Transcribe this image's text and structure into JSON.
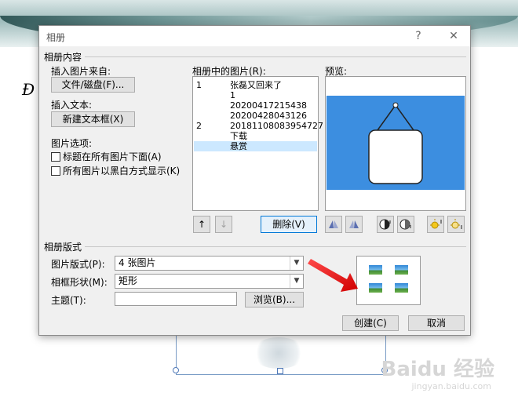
{
  "dialog": {
    "title": "相册",
    "help_glyph": "?",
    "close_glyph": "✕"
  },
  "album_content": {
    "group_label": "相册内容",
    "insert_picture_from": "插入图片来自:",
    "file_disk_button": "文件/磁盘(F)...",
    "insert_text": "插入文本:",
    "new_textbox_button": "新建文本框(X)",
    "picture_options": "图片选项:",
    "caption_below_all": "标题在所有图片下面(A)",
    "all_black_white": "所有图片以黑白方式显示(K)"
  },
  "pictures_list": {
    "label": "相册中的图片(R):",
    "items": [
      {
        "num": "1",
        "name": "张磊又回来了",
        "selected": false
      },
      {
        "num": "",
        "name": "1",
        "selected": false
      },
      {
        "num": "",
        "name": "20200417215438",
        "selected": false
      },
      {
        "num": "",
        "name": "20200428043126",
        "selected": false
      },
      {
        "num": "2",
        "name": "20181108083954727",
        "selected": false
      },
      {
        "num": "",
        "name": "下载",
        "selected": false
      },
      {
        "num": "",
        "name": "悬赏",
        "selected": true
      }
    ],
    "move_up_glyph": "↑",
    "move_down_glyph": "↓",
    "delete_button": "删除(V)"
  },
  "preview": {
    "label": "预览:",
    "background_color": "#3c8ee0",
    "tool_icons": [
      "rotate-left-icon",
      "rotate-right-icon",
      "contrast-up-icon",
      "contrast-down-icon",
      "brightness-up-icon",
      "brightness-down-icon"
    ]
  },
  "album_layout": {
    "group_label": "相册版式",
    "picture_layout_label": "图片版式(P):",
    "picture_layout_value": "4 张图片",
    "frame_shape_label": "相框形状(M):",
    "frame_shape_value": "矩形",
    "theme_label": "主题(T):",
    "theme_value": "",
    "browse_button": "浏览(B)..."
  },
  "footer": {
    "create_button": "创建(C)",
    "cancel_button": "取消"
  },
  "background": {
    "side_text": "Ð",
    "watermark": "Baidu 经验",
    "watermark_sub": "jingyan.baidu.com"
  }
}
